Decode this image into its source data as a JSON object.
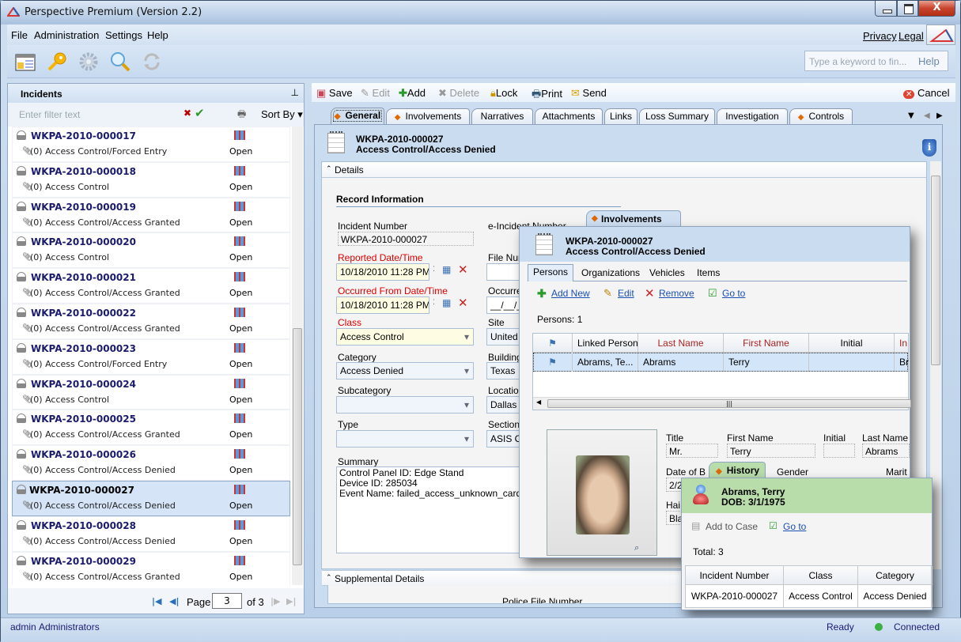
{
  "window": {
    "title": "Perspective Premium (Version 2.2)",
    "close_glyph": "X"
  },
  "menu": {
    "items": [
      "File",
      "Administration",
      "Settings",
      "Help"
    ],
    "links": [
      "Privacy",
      "Legal"
    ]
  },
  "toolbar": {
    "icons": [
      "layout-icon",
      "key-icon",
      "gear-icon",
      "search-icon",
      "refresh-icon"
    ],
    "search_placeholder": "Type a keyword to fin...",
    "help_label": "Help"
  },
  "incidents_panel": {
    "title": "Incidents",
    "pin_glyph": "📌",
    "filter_placeholder": "Enter filter text",
    "sort_label": "Sort By ▾",
    "items": [
      {
        "number": "WKPA-2010-000017",
        "attachments": "(0)",
        "description": "Access Control/Forced Entry",
        "status": "Open",
        "selected": false
      },
      {
        "number": "WKPA-2010-000018",
        "attachments": "(0)",
        "description": "Access Control",
        "status": "Open",
        "selected": false
      },
      {
        "number": "WKPA-2010-000019",
        "attachments": "(0)",
        "description": "Access Control/Access Granted",
        "status": "Open",
        "selected": false
      },
      {
        "number": "WKPA-2010-000020",
        "attachments": "(0)",
        "description": "Access Control",
        "status": "Open",
        "selected": false
      },
      {
        "number": "WKPA-2010-000021",
        "attachments": "(0)",
        "description": "Access Control/Access Granted",
        "status": "Open",
        "selected": false
      },
      {
        "number": "WKPA-2010-000022",
        "attachments": "(0)",
        "description": "Access Control/Access Granted",
        "status": "Open",
        "selected": false
      },
      {
        "number": "WKPA-2010-000023",
        "attachments": "(0)",
        "description": "Access Control/Forced Entry",
        "status": "Open",
        "selected": false
      },
      {
        "number": "WKPA-2010-000024",
        "attachments": "(0)",
        "description": "Access Control",
        "status": "Open",
        "selected": false
      },
      {
        "number": "WKPA-2010-000025",
        "attachments": "(0)",
        "description": "Access Control/Access Granted",
        "status": "Open",
        "selected": false
      },
      {
        "number": "WKPA-2010-000026",
        "attachments": "(0)",
        "description": "Access Control/Access Denied",
        "status": "Open",
        "selected": false
      },
      {
        "number": "WKPA-2010-000027",
        "attachments": "(0)",
        "description": "Access Control/Access Denied",
        "status": "Open",
        "selected": true
      },
      {
        "number": "WKPA-2010-000028",
        "attachments": "(0)",
        "description": "Access Control/Access Denied",
        "status": "Open",
        "selected": false
      },
      {
        "number": "WKPA-2010-000029",
        "attachments": "(0)",
        "description": "Access Control/Access Granted",
        "status": "Open",
        "selected": false
      }
    ],
    "pager": {
      "page_label": "Page",
      "current_page": "3",
      "of_label": "of 3"
    }
  },
  "record_toolbar": {
    "save": "Save",
    "edit": "Edit",
    "add": "Add",
    "delete": "Delete",
    "lock": "Lock",
    "print": "Print",
    "send": "Send",
    "cancel": "Cancel"
  },
  "tabs": [
    {
      "label": "General",
      "flag": true,
      "active": true
    },
    {
      "label": "Involvements",
      "flag": true,
      "active": false
    },
    {
      "label": "Narratives",
      "flag": false,
      "active": false
    },
    {
      "label": "Attachments",
      "flag": false,
      "active": false
    },
    {
      "label": "Links",
      "flag": false,
      "active": false
    },
    {
      "label": "Loss Summary",
      "flag": false,
      "active": false
    },
    {
      "label": "Investigation",
      "flag": false,
      "active": false
    },
    {
      "label": "Controls",
      "flag": true,
      "active": false
    }
  ],
  "record": {
    "number": "WKPA-2010-000027",
    "classification": "Access Control/Access Denied",
    "details_header": "Details",
    "section_title": "Record Information",
    "fields": {
      "incident_number": {
        "label": "Incident Number",
        "value": "WKPA-2010-000027"
      },
      "e_incident_number": {
        "label": "e-Incident Number",
        "value": ""
      },
      "reported": {
        "label": "Reported Date/Time",
        "value": "10/18/2010 11:28 PM"
      },
      "file_number": {
        "label": "File Number",
        "value": ""
      },
      "occurred_from": {
        "label": "Occurred From Date/Time",
        "value": "10/18/2010 11:28 PM"
      },
      "occurred_to": {
        "label": "Occurred To",
        "value": "__/__/__"
      },
      "class": {
        "label": "Class",
        "value": "Access Control"
      },
      "site": {
        "label": "Site",
        "value": "United S"
      },
      "category": {
        "label": "Category",
        "value": "Access Denied"
      },
      "building": {
        "label": "Building",
        "value": "Texas"
      },
      "subcategory": {
        "label": "Subcategory",
        "value": ""
      },
      "location": {
        "label": "Location",
        "value": "Dallas"
      },
      "type": {
        "label": "Type",
        "value": ""
      },
      "section": {
        "label": "Section",
        "value": "ASIS Co"
      },
      "summary": {
        "label": "Summary",
        "lines": [
          "Control Panel ID: Edge Stand",
          "Device ID: 285034",
          "Event Name: failed_access_unknown_card"
        ]
      }
    },
    "supplemental_header": "Supplemental Details",
    "supplemental_partial": "Police File Number"
  },
  "involvements_popup": {
    "tab_label": "Involvements",
    "number": "WKPA-2010-000027",
    "classification": "Access Control/Access Denied",
    "subtabs": [
      "Persons",
      "Organizations",
      "Vehicles",
      "Items"
    ],
    "actions": [
      "Add New",
      "Edit",
      "Remove",
      "Go to"
    ],
    "count_label": "Persons: 1",
    "columns": [
      "",
      "Linked Person",
      "Last Name",
      "First Name",
      "Initial",
      "In"
    ],
    "rows": [
      [
        "",
        "Abrams, Te...",
        "Abrams",
        "Terry",
        "",
        "Br"
      ]
    ],
    "person": {
      "title_label": "Title",
      "title": "Mr.",
      "first_label": "First Name",
      "first": "Terry",
      "initial_label": "Initial",
      "initial": "",
      "last_label": "Last Name",
      "last": "Abrams",
      "dob_label": "Date of B",
      "dob": "2/2",
      "gender_label": "Gender",
      "marital_label": "Marit",
      "hair_label": "Hai",
      "hair": "Bla"
    }
  },
  "history_popup": {
    "tab_label": "History",
    "name": "Abrams, Terry",
    "dob": "DOB: 3/1/1975",
    "actions": [
      "Add to Case",
      "Go to"
    ],
    "total_label": "Total: 3",
    "columns": [
      "Incident Number",
      "Class",
      "Category"
    ],
    "rows": [
      [
        "WKPA-2010-000027",
        "Access Control",
        "Access Denied"
      ]
    ]
  },
  "statusbar": {
    "user": "admin",
    "role": "Administrators",
    "state": "Ready",
    "connection": "Connected"
  },
  "colors": {
    "accent": "#1b1b6e",
    "required": "#dd0000",
    "connected": "#3cb043",
    "history_bg": "#b8dcaa"
  }
}
